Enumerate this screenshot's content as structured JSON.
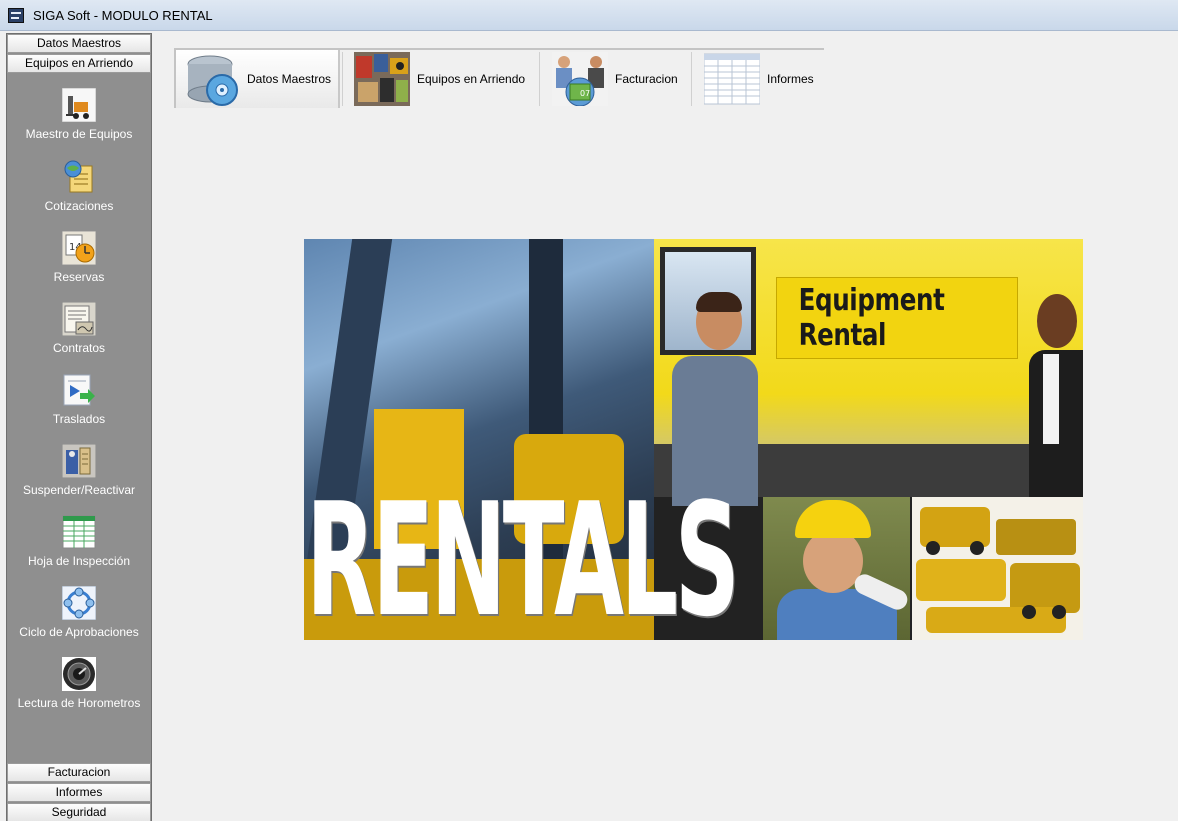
{
  "window": {
    "title": "SIGA Soft - MODULO RENTAL",
    "icon": "app-icon"
  },
  "sidebar": {
    "top_sections": [
      "Datos Maestros",
      "Equipos en Arriendo"
    ],
    "items": [
      {
        "label": "Maestro de Equipos",
        "icon": "forklift-icon"
      },
      {
        "label": "Cotizaciones",
        "icon": "globe-document-icon"
      },
      {
        "label": "Reservas",
        "icon": "calendar-clock-icon"
      },
      {
        "label": "Contratos",
        "icon": "contract-icon"
      },
      {
        "label": "Traslados",
        "icon": "transfer-arrow-icon"
      },
      {
        "label": "Suspender/Reactivar",
        "icon": "suspend-icon"
      },
      {
        "label": "Hoja de Inspección",
        "icon": "spreadsheet-icon"
      },
      {
        "label": "Ciclo de Aprobaciones",
        "icon": "cycle-icon"
      },
      {
        "label": "Lectura de Horometros",
        "icon": "gauge-icon"
      }
    ],
    "bottom_sections": [
      "Facturacion",
      "Informes",
      "Seguridad"
    ]
  },
  "toolbar": {
    "buttons": [
      {
        "label": "Datos Maestros",
        "icon": "database-disk-icon",
        "active": true
      },
      {
        "label": "Equipos en Arriendo",
        "icon": "equipment-collage-icon",
        "active": false
      },
      {
        "label": "Facturacion",
        "icon": "invoice-people-icon",
        "active": false
      },
      {
        "label": "Informes",
        "icon": "report-table-icon",
        "active": false
      }
    ]
  },
  "banner": {
    "sign_text": "Equipment Rental",
    "big_text": "RENTALS"
  },
  "colors": {
    "sidebar_bg": "#8f8f8f",
    "titlebar": "#c9d8ea",
    "sign_yellow": "#f2d410"
  }
}
